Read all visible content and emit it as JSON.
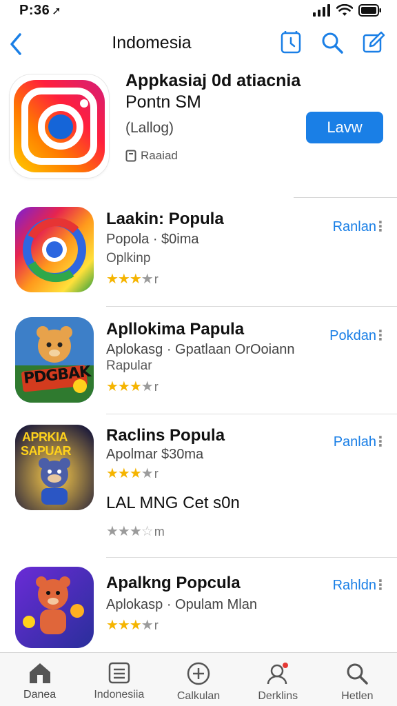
{
  "status_bar": {
    "time": "P:36"
  },
  "nav": {
    "title": "Indomesia"
  },
  "hero": {
    "title_line1": "Appkasiaj 0d atiacnia",
    "title_line2": "Pontn SM",
    "subtitle": "(Lallog)",
    "tag": "Raaiad",
    "button_label": "Lavw"
  },
  "apps": [
    {
      "title": "Laakin: Popula",
      "line2": "Popola · $0ima",
      "line3": "Oplkinp",
      "rating": 3,
      "rating_tail": "r",
      "action": "Ranlan"
    },
    {
      "title": "Apllokima Papula",
      "line2": "Aplokasg · Gpatlaan OrOoiann",
      "line3": "Rapular",
      "rating": 3,
      "rating_tail": "r",
      "action": "Pokdan"
    },
    {
      "title": "Raclins Popula",
      "line2": "Apolmar  $30ma",
      "rating": 3,
      "rating_tail": "r",
      "action": "Panlah",
      "icon_text_1": "APRKIA",
      "icon_text_2": "SAPUAR"
    },
    {
      "title": "Apalkng Popcula",
      "line2": "Aplokasp · Opulam Mlan",
      "rating": 3,
      "rating_tail": "r",
      "action": "Rahldn"
    }
  ],
  "extra": {
    "title": "LAL MNG Cet s0n",
    "rating": 3,
    "rating_tail": "m"
  },
  "icon2_text": "PDGBAK",
  "tabs": [
    {
      "label": "Danea",
      "icon": "home-icon"
    },
    {
      "label": "Indonesiia",
      "icon": "list-icon"
    },
    {
      "label": "Calkulan",
      "icon": "plus-circle-icon"
    },
    {
      "label": "Derklins",
      "icon": "person-icon"
    },
    {
      "label": "Hetlen",
      "icon": "search-icon"
    }
  ],
  "colors": {
    "accent": "#1a7fe6",
    "star": "#f5b400"
  }
}
